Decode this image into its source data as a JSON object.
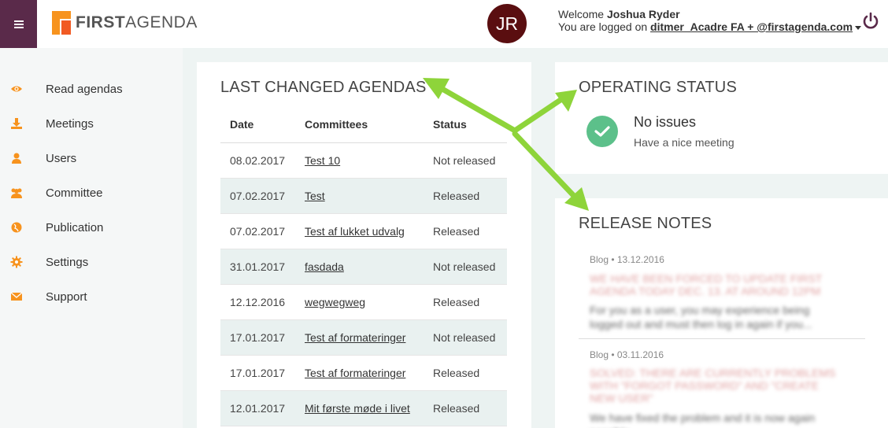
{
  "header": {
    "logo_bold": "FIRST",
    "logo_light": "AGENDA",
    "avatar_initials": "JR",
    "welcome_prefix": "Welcome",
    "user_name": "Joshua Ryder",
    "logged_prefix": "You are logged on",
    "account": "ditmer_Acadre FA + @firstagenda.com",
    "menu_icon": "hamburger-icon",
    "power_icon": "power-icon"
  },
  "sidebar": {
    "items": [
      {
        "label": "Read agendas",
        "icon": "eye-icon"
      },
      {
        "label": "Meetings",
        "icon": "download-icon"
      },
      {
        "label": "Users",
        "icon": "user-icon"
      },
      {
        "label": "Committee",
        "icon": "users-icon"
      },
      {
        "label": "Publication",
        "icon": "globe-icon"
      },
      {
        "label": "Settings",
        "icon": "gear-icon"
      },
      {
        "label": "Support",
        "icon": "envelope-icon"
      }
    ],
    "icon_color": "#f7931e"
  },
  "agendas": {
    "title": "LAST CHANGED AGENDAS",
    "columns": [
      "Date",
      "Committees",
      "Status"
    ],
    "rows": [
      {
        "date": "08.02.2017",
        "committee": "Test 10",
        "status": "Not released"
      },
      {
        "date": "07.02.2017",
        "committee": "Test",
        "status": "Released"
      },
      {
        "date": "07.02.2017",
        "committee": "Test af lukket udvalg",
        "status": "Released"
      },
      {
        "date": "31.01.2017",
        "committee": "fasdada",
        "status": "Not released"
      },
      {
        "date": "12.12.2016",
        "committee": "wegwegweg",
        "status": "Released"
      },
      {
        "date": "17.01.2017",
        "committee": "Test af formateringer",
        "status": "Not released"
      },
      {
        "date": "17.01.2017",
        "committee": "Test af formateringer",
        "status": "Released"
      },
      {
        "date": "12.01.2017",
        "committee": "Mit første møde i livet",
        "status": "Released"
      }
    ]
  },
  "operating_status": {
    "title": "OPERATING STATUS",
    "status": "No issues",
    "message": "Have a nice meeting",
    "color": "#5cc08a"
  },
  "release_notes": {
    "title": "RELEASE NOTES",
    "notes": [
      {
        "meta": "Blog • 13.12.2016",
        "title": "WE HAVE BEEN FORCED TO UPDATE FIRST AGENDA TODAY DEC. 13. AT AROUND 12PM",
        "body": "For you as a user, you may experience being logged out and must then log in again if you..."
      },
      {
        "meta": "Blog • 03.11.2016",
        "title": "SOLVED: THERE ARE CURRENTLY PROBLEMS WITH \"FORGOT PASSWORD\" AND \"CREATE NEW USER\"",
        "body": "We have fixed the problem and it is now again possible..."
      }
    ]
  },
  "colors": {
    "brand": "#5a2a4a",
    "accent": "#f7931e",
    "annotation_arrow": "#8ed43a"
  }
}
